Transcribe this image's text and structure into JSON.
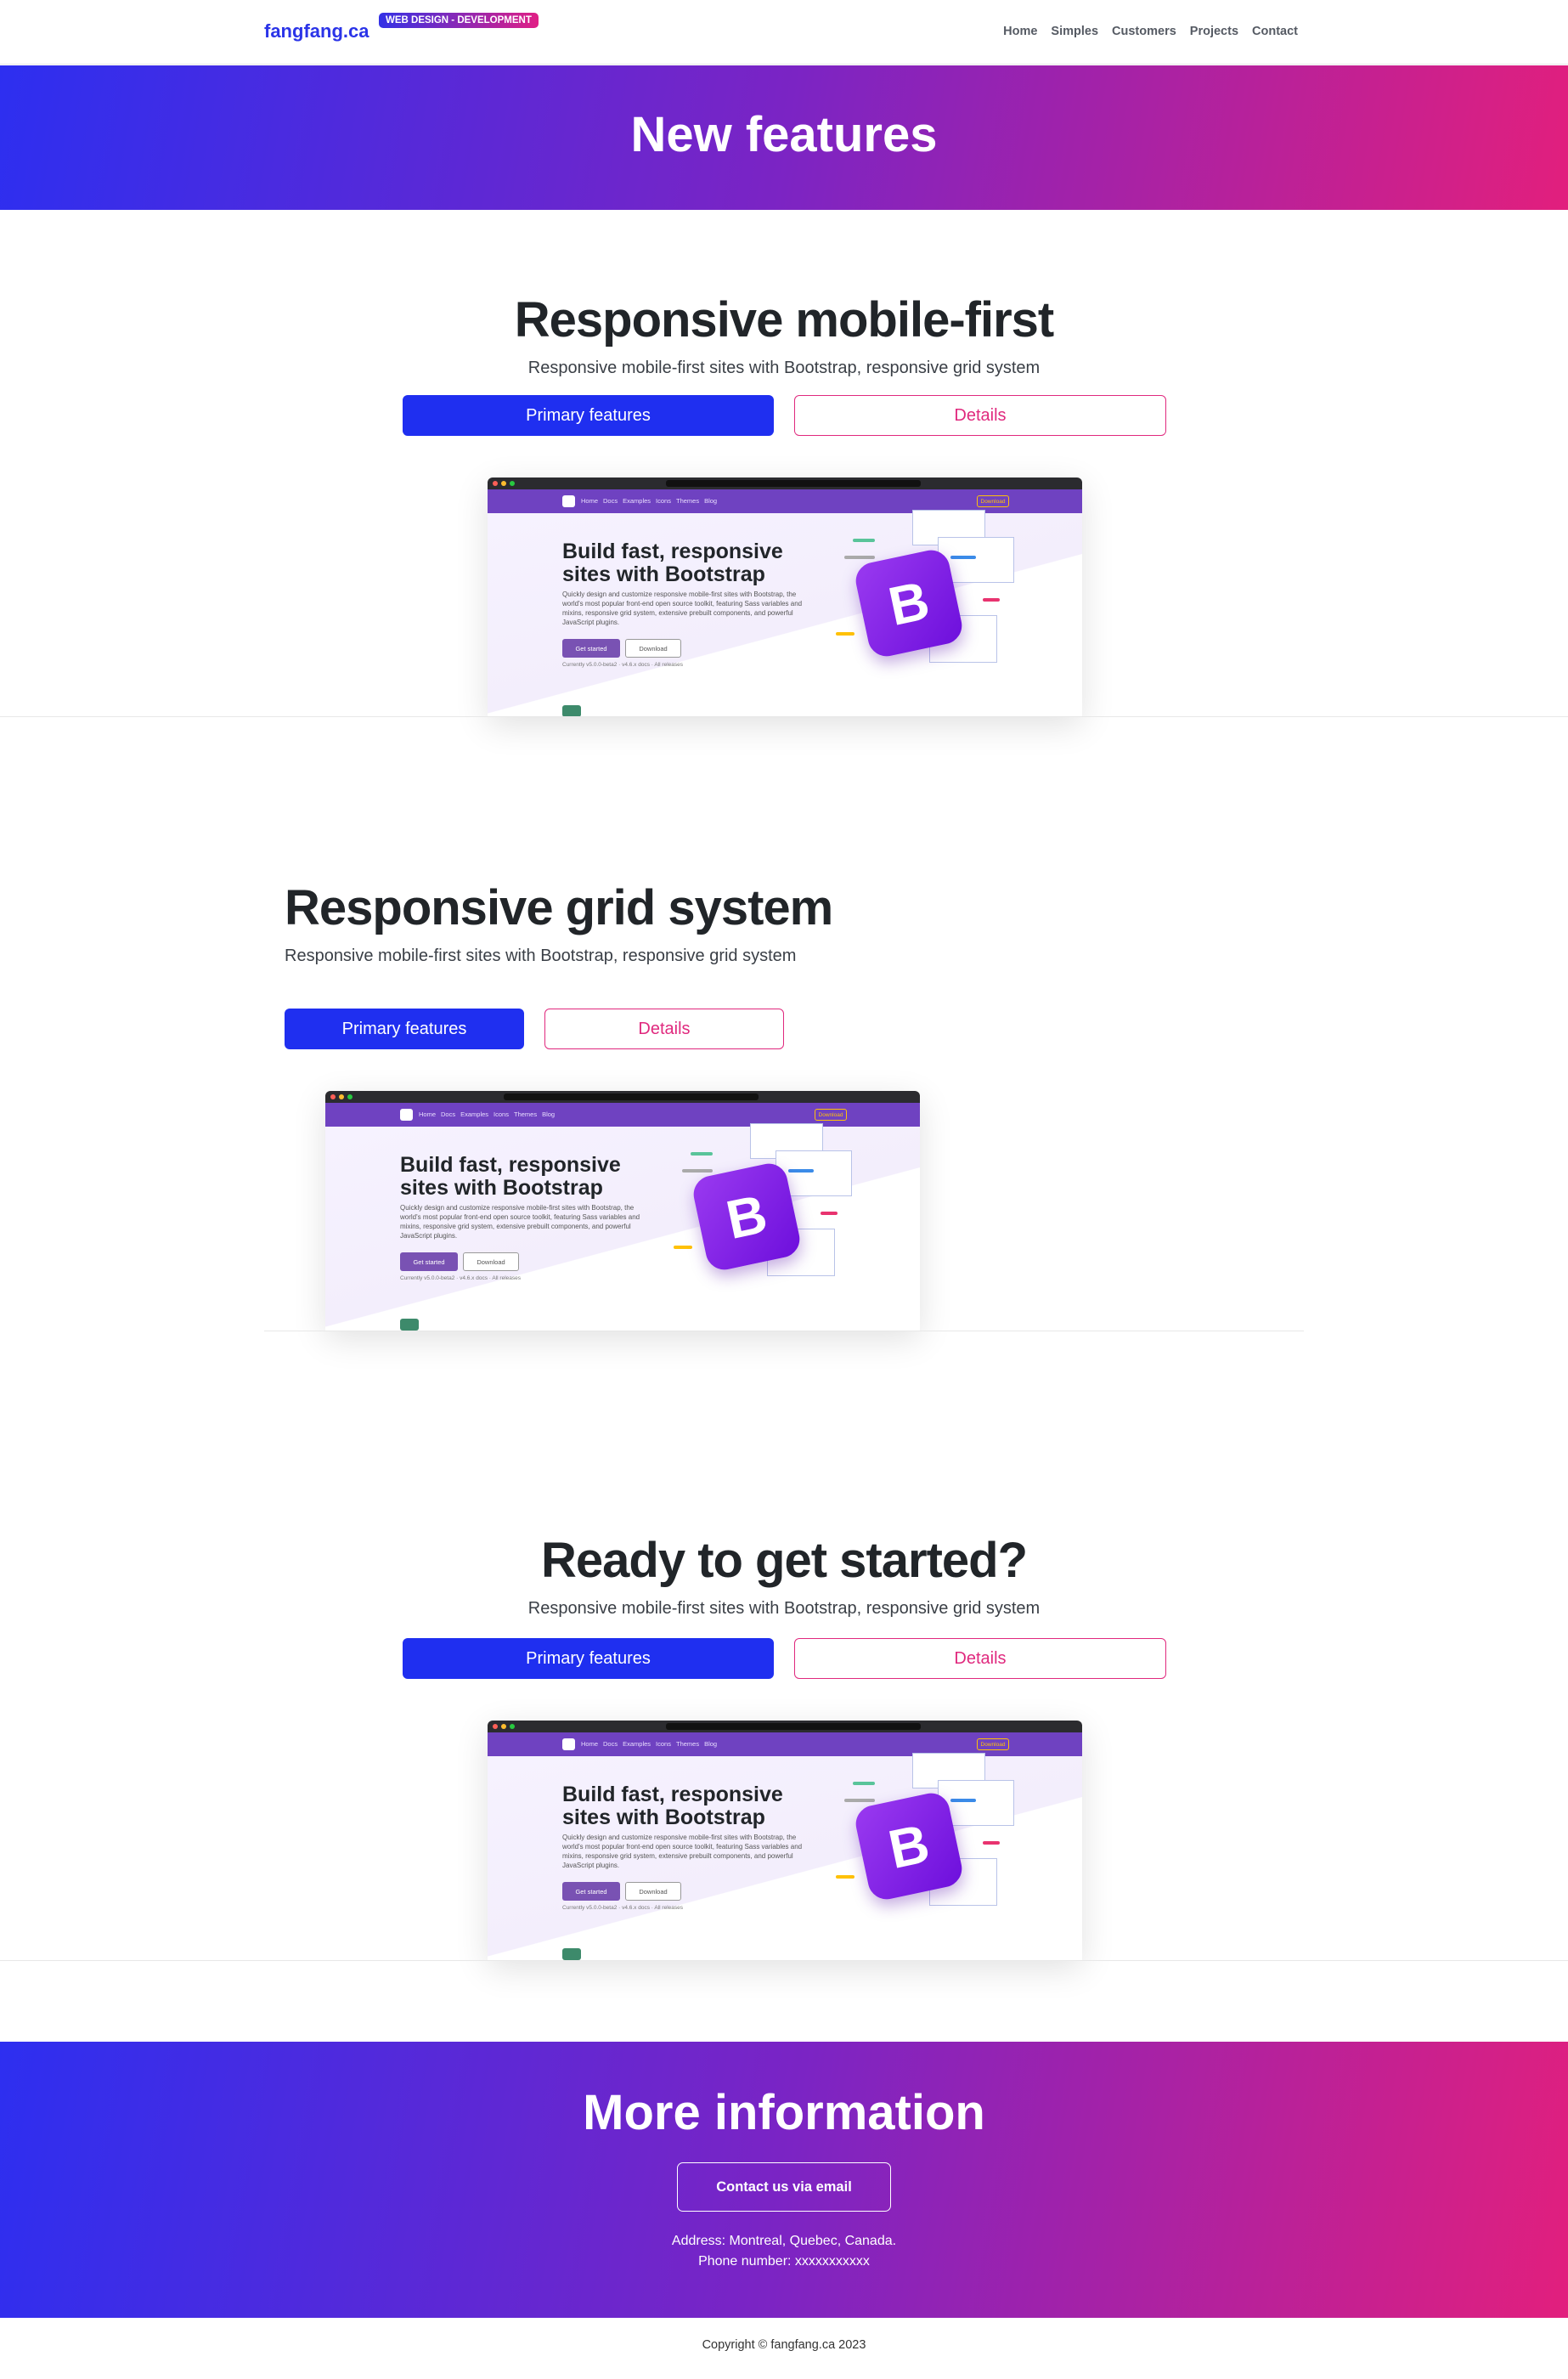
{
  "navbar": {
    "brand": "fangfang.ca",
    "badge": "WEB DESIGN - DEVELOPMENT",
    "links": [
      "Home",
      "Simples",
      "Customers",
      "Projects",
      "Contact"
    ]
  },
  "hero": {
    "title": "New features"
  },
  "sections": [
    {
      "title": "Responsive mobile-first",
      "subtitle": "Responsive mobile-first sites with Bootstrap, responsive grid system",
      "primary_label": "Primary features",
      "secondary_label": "Details"
    },
    {
      "title": "Responsive grid system",
      "subtitle": "Responsive mobile-first sites with Bootstrap, responsive grid system",
      "primary_label": "Primary features",
      "secondary_label": "Details"
    },
    {
      "title": "Ready to get started?",
      "subtitle": "Responsive mobile-first sites with Bootstrap, responsive grid system",
      "primary_label": "Primary features",
      "secondary_label": "Details"
    }
  ],
  "mock": {
    "nav_items": [
      "Home",
      "Docs",
      "Examples",
      "Icons",
      "Themes",
      "Blog"
    ],
    "nav_download": "Download",
    "headline": "Build fast, responsive sites with Bootstrap",
    "paragraph": "Quickly design and customize responsive mobile-first sites with Bootstrap, the world's most popular front-end open source toolkit, featuring Sass variables and mixins, responsive grid system, extensive prebuilt components, and powerful JavaScript plugins.",
    "get_started": "Get started",
    "download": "Download",
    "currently": "Currently v5.0.0-beta2 · v4.6.x docs · All releases",
    "logo_letter": "B"
  },
  "more": {
    "title": "More information",
    "contact_button": "Contact us via email",
    "address": "Address: Montreal, Quebec, Canada.",
    "phone": "Phone number: xxxxxxxxxxx"
  },
  "footer": {
    "copyright": "Copyright © fangfang.ca 2023"
  },
  "colors": {
    "primary": "#1f2ff0",
    "accent": "#e0297e",
    "brand": "#2b34e8",
    "mock_purple": "#6f42c1"
  }
}
